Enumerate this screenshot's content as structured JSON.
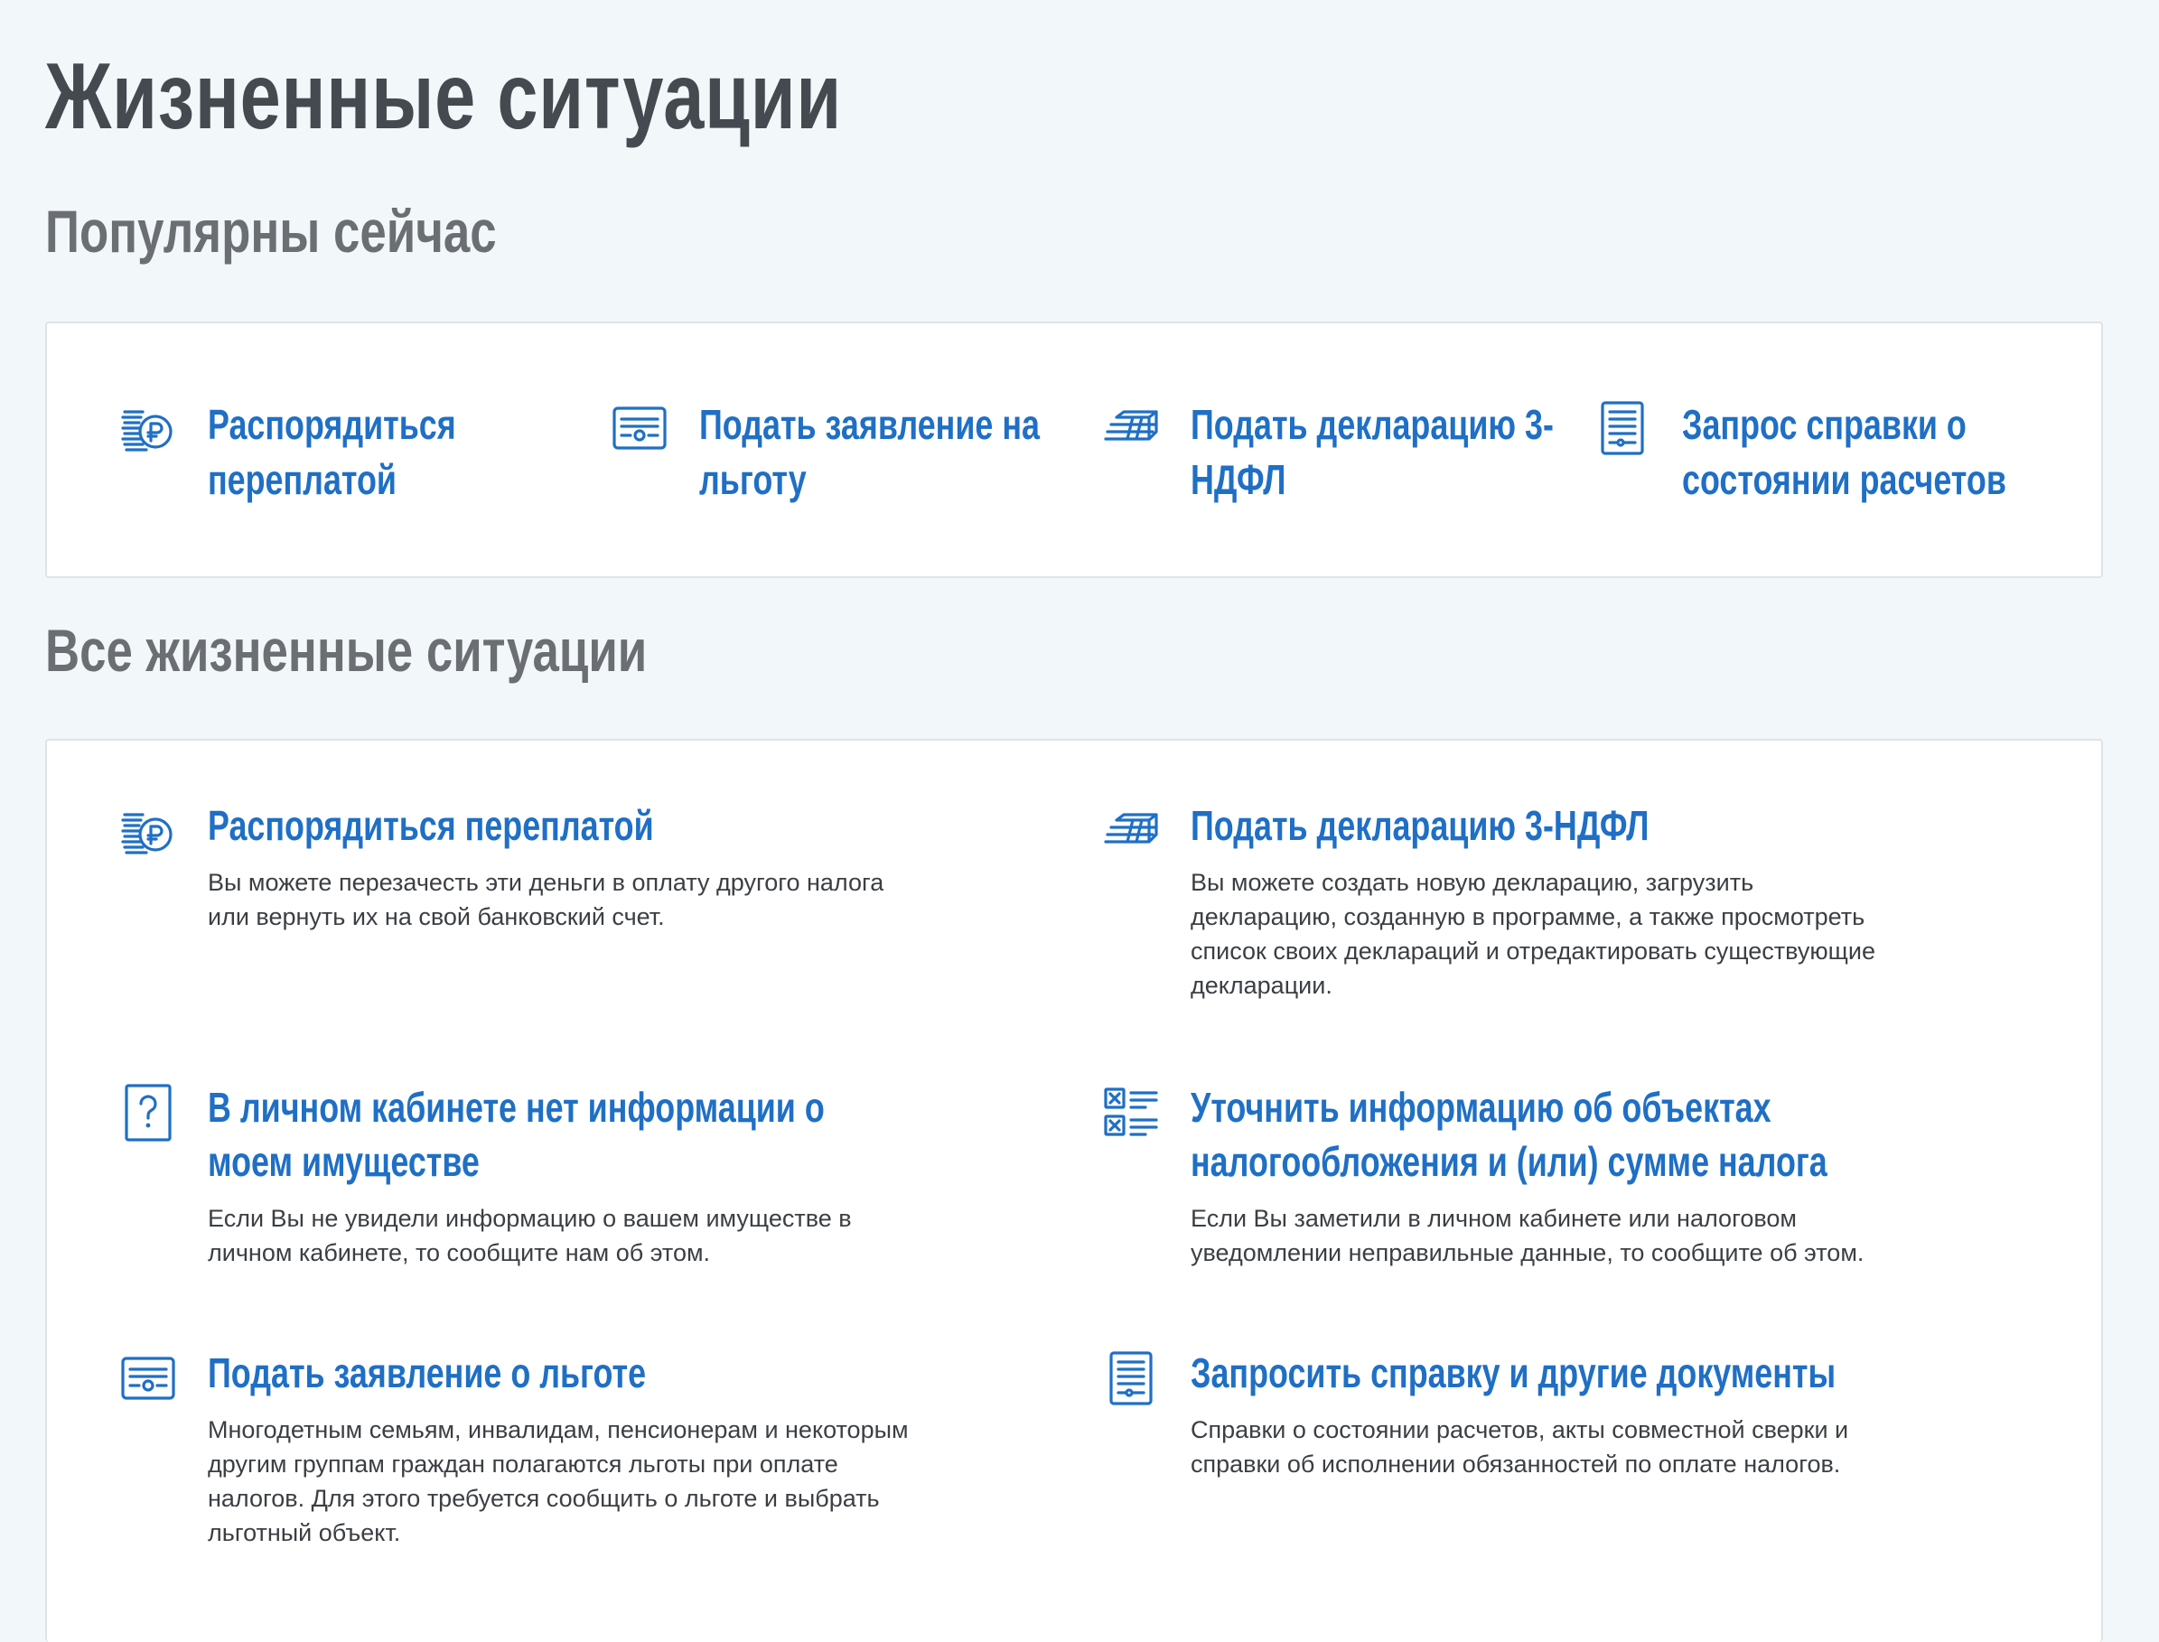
{
  "page": {
    "title": "Жизненные ситуации"
  },
  "popular": {
    "title": "Популярны сейчас",
    "items": [
      {
        "label": "Распорядиться переплатой",
        "icon": "ruble-coin-icon"
      },
      {
        "label": "Подать заявление на льготу",
        "icon": "certificate-icon"
      },
      {
        "label": "Подать декларацию 3-НДФЛ",
        "icon": "document-stack-icon"
      },
      {
        "label": "Запрос справки о состоянии расчетов",
        "icon": "document-list-icon"
      }
    ]
  },
  "all": {
    "title": "Все жизненные ситуации",
    "items": [
      {
        "title": "Распорядиться переплатой",
        "desc": "Вы можете перезачесть эти деньги в оплату другого налога или вернуть их на свой банковский счет.",
        "icon": "ruble-coin-icon"
      },
      {
        "title": "Подать декларацию 3-НДФЛ",
        "desc": "Вы можете создать новую декларацию, загрузить декларацию, созданную в программе, а также просмотреть список своих деклараций и отредактировать существующие декларации.",
        "icon": "document-stack-icon"
      },
      {
        "title": "В личном кабинете нет информации о моем имуществе",
        "desc": "Если Вы не увидели информацию о вашем имуществе в личном кабинете, то сообщите нам об этом.",
        "icon": "question-document-icon"
      },
      {
        "title": "Уточнить информацию об объектах налогообложения и (или) сумме налога",
        "desc": "Если Вы заметили в личном кабинете или налоговом уведомлении неправильные данные, то сообщите об этом.",
        "icon": "checklist-icon"
      },
      {
        "title": "Подать заявление о льготе",
        "desc": "Многодетным семьям, инвалидам, пенсионерам и некоторым другим группам граждан полагаются льготы при оплате налогов. Для этого требуется сообщить о льготе и выбрать льготный объект.",
        "icon": "certificate-icon"
      },
      {
        "title": "Запросить справку и другие документы",
        "desc": "Справки о состоянии расчетов, акты совместной сверки и справки об исполнении обязанностей по оплате налогов.",
        "icon": "document-list-icon"
      }
    ]
  },
  "colors": {
    "accent": "#1f6fc5",
    "background": "#f2f7f9",
    "heading": "#444a50",
    "subheading": "#6b6f73",
    "text": "#3b3f43"
  }
}
